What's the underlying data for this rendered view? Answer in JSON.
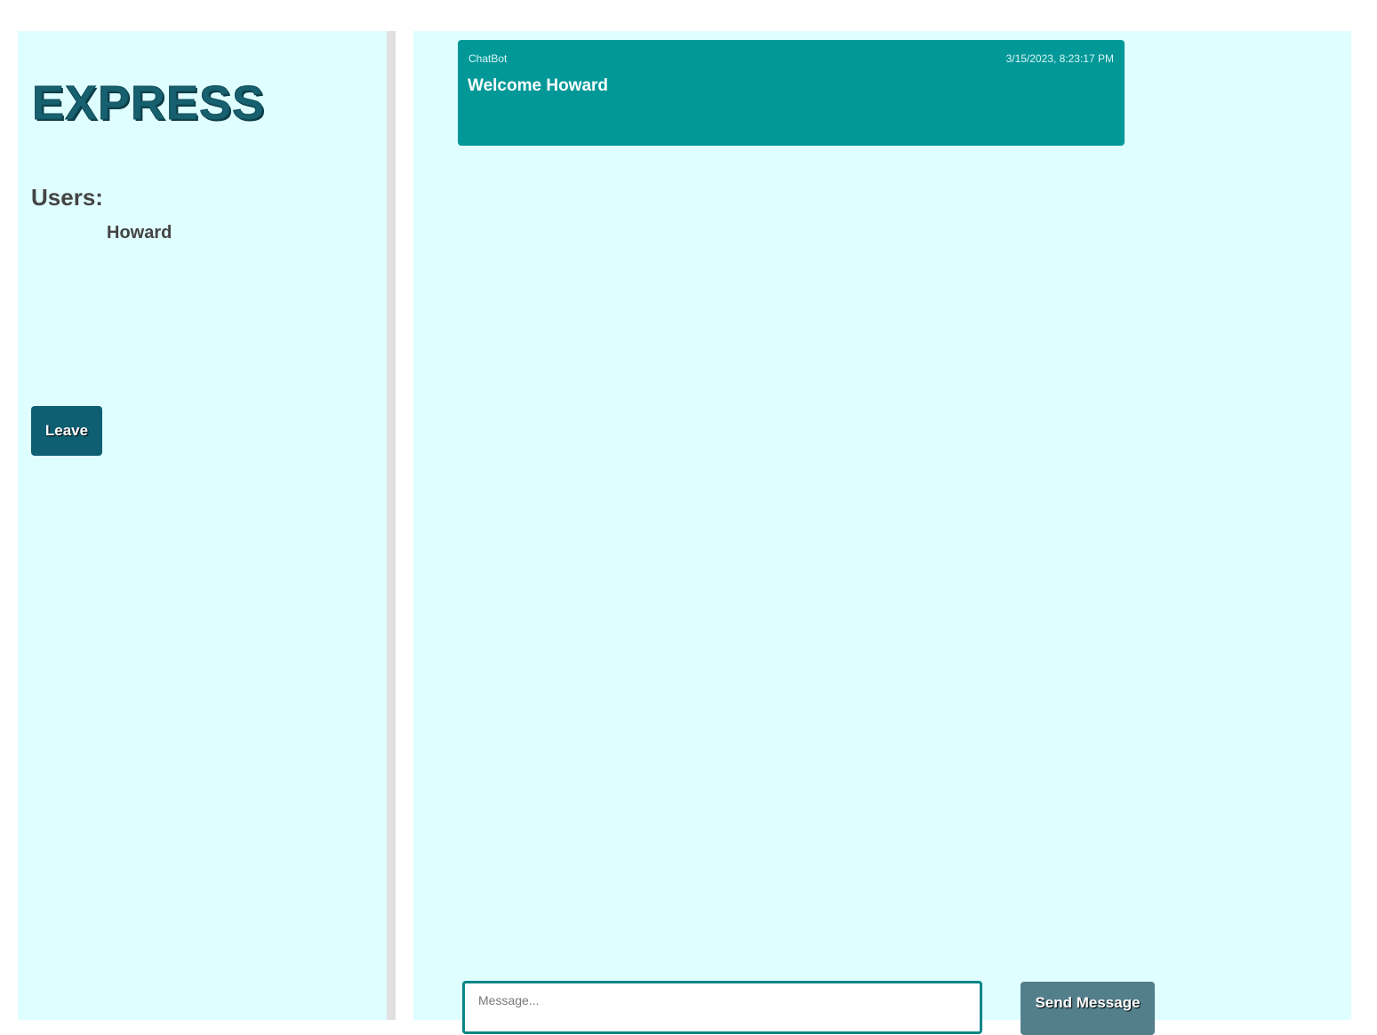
{
  "brand": {
    "title": "EXPRESS",
    "color": "#17606f"
  },
  "sidebar": {
    "users_heading": "Users:",
    "users": [
      "Howard"
    ],
    "leave_label": "Leave",
    "background": "#dffeff"
  },
  "chat": {
    "messages": [
      {
        "author": "ChatBot",
        "timestamp": "3/15/2023, 8:23:17 PM",
        "text": "Welcome Howard",
        "color": "#039898"
      }
    ]
  },
  "composer": {
    "placeholder": "Message...",
    "value": "",
    "send_label": "Send Message",
    "send_color": "#537f8b"
  }
}
